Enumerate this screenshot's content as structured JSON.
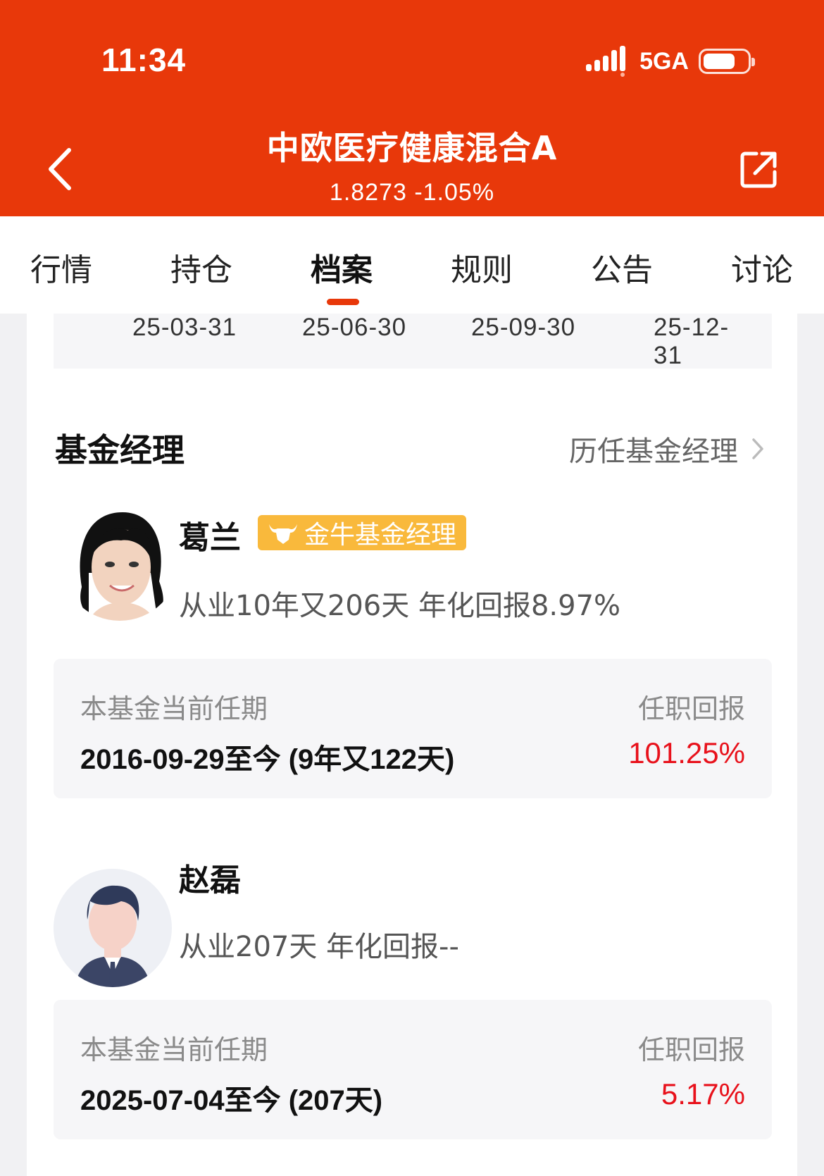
{
  "status_bar": {
    "time": "11:34",
    "network": "5GA",
    "battery_level": 0.75
  },
  "header": {
    "title": "中欧医疗健康混合A",
    "subtitle": "1.8273 -1.05%",
    "accent_color": "#e8380a"
  },
  "tabs": [
    {
      "label": "行情"
    },
    {
      "label": "持仓"
    },
    {
      "label": "档案",
      "active": true
    },
    {
      "label": "规则"
    },
    {
      "label": "公告"
    },
    {
      "label": "讨论"
    }
  ],
  "dates": [
    "25-03-31",
    "25-06-30",
    "25-09-30",
    "25-12-31"
  ],
  "managers_section": {
    "title": "基金经理",
    "history_link": "历任基金经理"
  },
  "managers": [
    {
      "name": "葛兰",
      "badge": "金牛基金经理",
      "meta": "从业10年又206天 年化回报8.97%",
      "tenure_label": "本基金当前任期",
      "tenure_value": "2016-09-29至今 (9年又122天)",
      "return_label": "任职回报",
      "return_value": "101.25%"
    },
    {
      "name": "赵磊",
      "meta": "从业207天 年化回报--",
      "tenure_label": "本基金当前任期",
      "tenure_value": "2025-07-04至今 (207天)",
      "return_label": "任职回报",
      "return_value": "5.17%"
    }
  ]
}
